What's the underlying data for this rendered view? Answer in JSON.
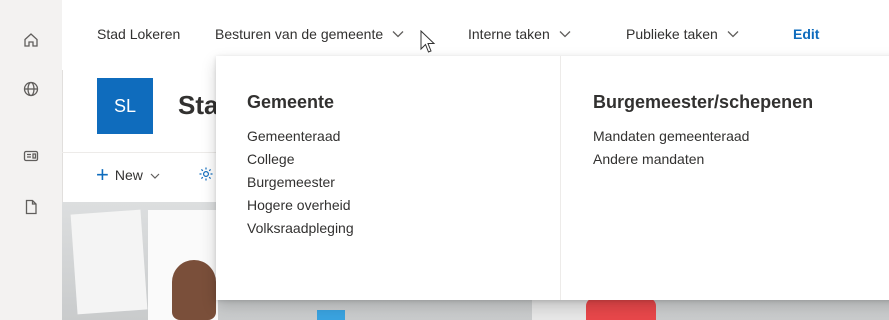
{
  "app_bar": {
    "icons": [
      "home-icon",
      "globe-icon",
      "news-icon",
      "document-icon"
    ]
  },
  "nav": {
    "items": [
      {
        "label": "Stad Lokeren"
      },
      {
        "label": "Besturen van de gemeente"
      },
      {
        "label": "Interne taken"
      },
      {
        "label": "Publieke taken"
      }
    ],
    "edit_label": "Edit"
  },
  "site": {
    "logo_text": "SL",
    "title": "Sta"
  },
  "command_bar": {
    "new_label": "New"
  },
  "mega_menu": {
    "columns": [
      {
        "heading": "Gemeente",
        "links": [
          "Gemeenteraad",
          "College",
          "Burgemeester",
          "Hogere overheid",
          "Volksraadpleging"
        ]
      },
      {
        "heading": "Burgemeester/schepenen",
        "links": [
          "Mandaten gemeenteraad",
          "Andere mandaten"
        ]
      }
    ]
  },
  "colors": {
    "accent": "#0f6cbd",
    "text": "#323130",
    "app_bar_bg": "#f3f2f1"
  }
}
